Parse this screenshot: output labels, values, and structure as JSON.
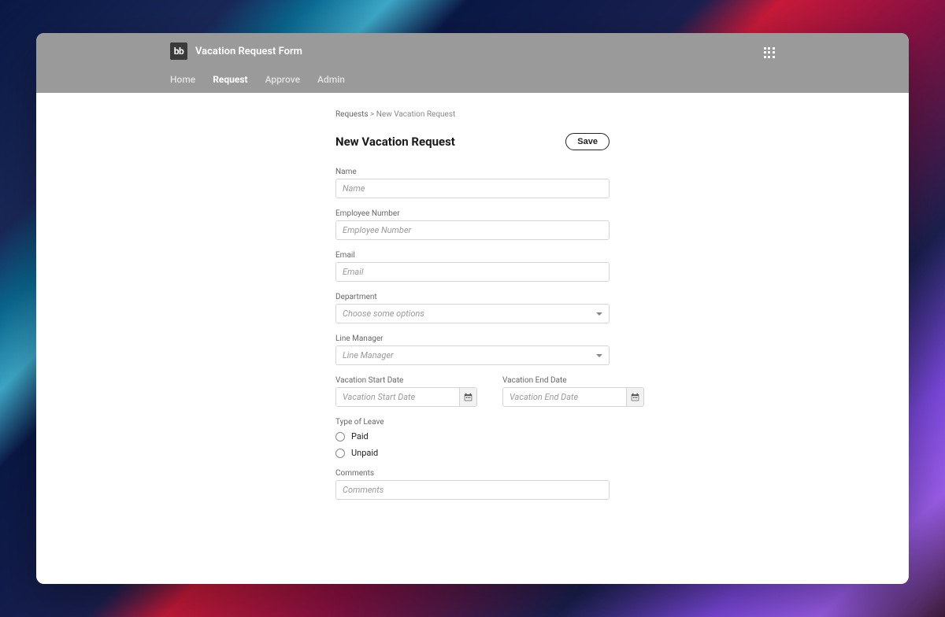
{
  "logo_text": "bb",
  "app_title": "Vacation Request Form",
  "nav": {
    "items": [
      {
        "label": "Home",
        "active": false
      },
      {
        "label": "Request",
        "active": true
      },
      {
        "label": "Approve",
        "active": false
      },
      {
        "label": "Admin",
        "active": false
      }
    ]
  },
  "breadcrumb": {
    "parent": "Requests",
    "sep": ">",
    "current": "New Vacation Request"
  },
  "page_title": "New Vacation Request",
  "buttons": {
    "save": "Save"
  },
  "fields": {
    "name": {
      "label": "Name",
      "placeholder": "Name"
    },
    "employee_number": {
      "label": "Employee Number",
      "placeholder": "Employee Number"
    },
    "email": {
      "label": "Email",
      "placeholder": "Email"
    },
    "department": {
      "label": "Department",
      "placeholder": "Choose some options"
    },
    "line_manager": {
      "label": "Line Manager",
      "placeholder": "Line Manager"
    },
    "start_date": {
      "label": "Vacation Start Date",
      "placeholder": "Vacation Start Date"
    },
    "end_date": {
      "label": "Vacation End Date",
      "placeholder": "Vacation End Date"
    },
    "type_of_leave": {
      "label": "Type of Leave",
      "options": {
        "paid": "Paid",
        "unpaid": "Unpaid"
      }
    },
    "comments": {
      "label": "Comments",
      "placeholder": "Comments"
    }
  }
}
